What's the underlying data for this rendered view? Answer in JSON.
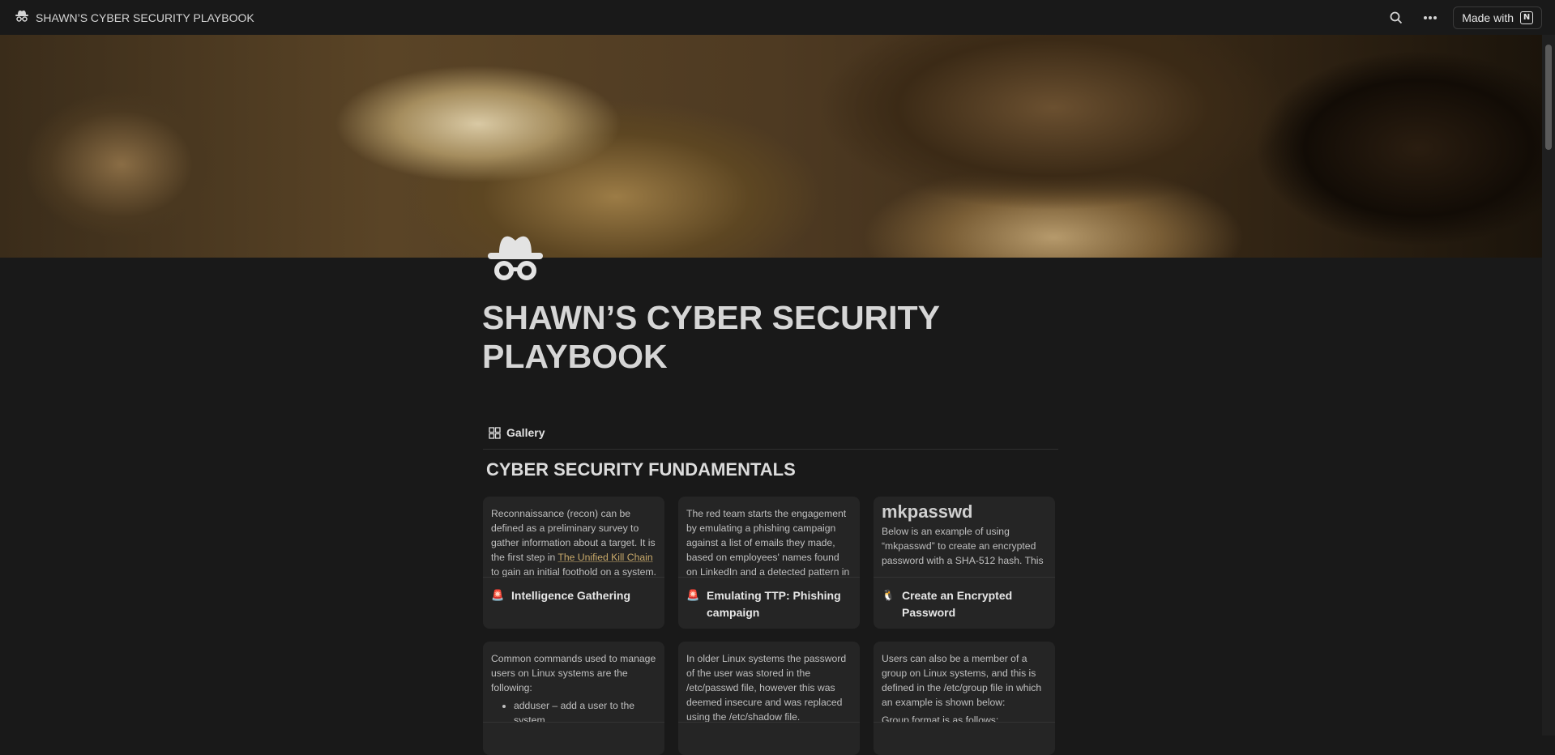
{
  "topbar": {
    "title": "SHAWN’S CYBER SECURITY PLAYBOOK",
    "made_with": "Made with"
  },
  "page": {
    "title": "SHAWN’S CYBER SECURITY PLAYBOOK",
    "view_tab": "Gallery",
    "section_title": "CYBER SECURITY FUNDAMENTALS"
  },
  "cards": [
    {
      "preview_pre": "Reconnaissance (recon) can be defined as a preliminary survey to gather information about a target. It is the first step in ",
      "preview_link": "The Unified Kill Chain",
      "preview_post": " to gain an initial foothold on a system.",
      "emoji": "🚨",
      "title": "Intelligence Gathering"
    },
    {
      "preview": "The red team starts the engagement by emulating a phishing campaign against a list of emails they made, based on employees' names found on LinkedIn and a detected pattern in",
      "emoji": "🚨",
      "title": "Emulating TTP: Phishing campaign"
    },
    {
      "preview_heading": "mkpasswd",
      "preview": "Below is an example of using “mkpasswd” to create an encrypted password with a SHA-512 hash. This",
      "emoji": "🐧",
      "title": "Create an Encrypted Password"
    },
    {
      "preview": "Common commands used to manage users on Linux systems are the following:",
      "preview_bullet": "adduser – add a user to the system",
      "emoji": "🐧",
      "title": ""
    },
    {
      "preview": "In older Linux systems the password of the user was stored in the /etc/passwd file, however this was deemed insecure and was replaced using the /etc/shadow file.",
      "emoji": "🐧",
      "title": ""
    },
    {
      "preview": "Users can also be a member of a group on Linux systems, and this is defined in the /etc/group file in which an example is shown below:",
      "preview_extra": "Group format is as follows:",
      "emoji": "🐧",
      "title": ""
    }
  ]
}
